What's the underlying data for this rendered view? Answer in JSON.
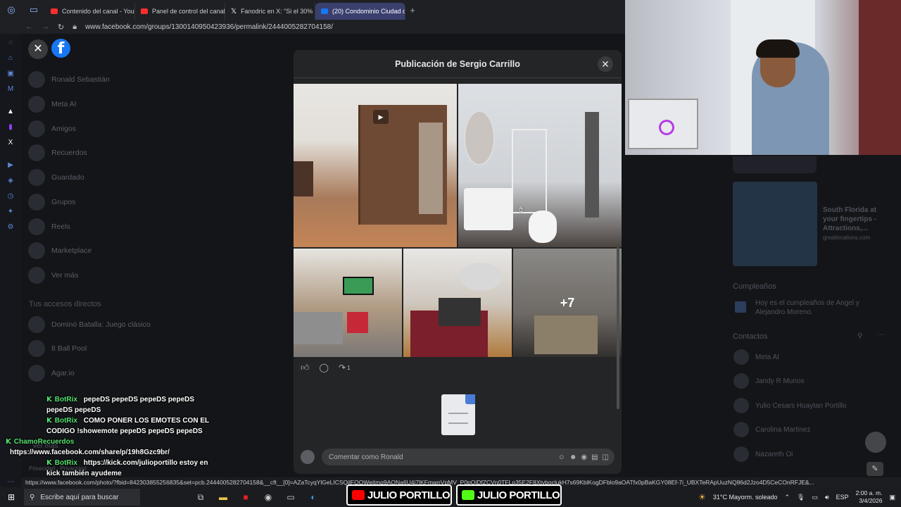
{
  "browser": {
    "tabs": [
      {
        "label": "Contenido del canal - YouT",
        "color": "#ff2d2d"
      },
      {
        "label": "Panel de control del canal",
        "color": "#ff2d2d"
      },
      {
        "label": "Fanodric en X: \"Si el 30%",
        "color": "#ffffff"
      },
      {
        "label": "(20) Condominio Ciudad d",
        "color": "#1877f2"
      }
    ],
    "url": "www.facebook.com/groups/1300140950423936/permalink/2444005282704158/"
  },
  "sidebar": {
    "items": [
      "Ronald Sebastián",
      "Meta AI",
      "Amigos",
      "Recuerdos",
      "Guardado",
      "Grupos",
      "Reels",
      "Marketplace",
      "Ver más"
    ],
    "shortcuts_heading": "Tus accesos directos",
    "shortcuts": [
      "Dominó Batalla: Juego clásico",
      "8 Ball Pool",
      "Agar.io"
    ],
    "more": "Ver más",
    "footer": "Privacidad · Privacidad"
  },
  "modal": {
    "title": "Publicación de Sergio Carrillo",
    "more_photos": "+7",
    "share_count": "1",
    "comment_placeholder": "Comentar como Ronald"
  },
  "right": {
    "ad_text": "South Florida at your fingertips - Attractions,...",
    "ad_domain": "greatlocations.com",
    "birthdays_heading": "Cumpleaños",
    "birthday_text": "Hoy es el cumpleaños de Angel y Alejandro Moreno.",
    "contacts_heading": "Contactos",
    "contacts": [
      "Meta AI",
      "Jandy R Munos",
      "Yulio Cesars Huaytan Portillo",
      "Carolina Martinez",
      "Nazareth Oi"
    ]
  },
  "chat": [
    {
      "user": "BotRix",
      "text": "pepeDS pepeDS pepeDS pepeDS pepeDS pepeDS"
    },
    {
      "user": "BotRix",
      "text": "COMO PONER LOS EMOTES CON EL CODIGO !showemote pepeDS pepeDS pepeDS"
    },
    {
      "user": "ChamoRecuerdos",
      "text": "https://www.facebook.com/share/p/19h8Gzc9br/"
    },
    {
      "user": "BotRix",
      "text": "https://kick.com/julioportillo estoy en kick también ayudeme"
    }
  ],
  "status_url": "https://www.facebook.com/photo/?fbid=842303855256835&set=pcb.2444005282704158&__cft__[0]=AZaTcyqYlGeLICSQjlFQQWeitmq9AQNa6U4j7lKFmwnVpMV_P0pQiDfZCVn0TFLp35E2F8XtvboclukH7s69KblKogDFblo9aOATfx0pBaKGY08Ef-7i_UBXTeRApUuzNQ86d2Jzo4D5CeCOnRFJE&...",
  "taskbar": {
    "search_placeholder": "Escribe aquí para buscar",
    "banner_left": "JULIO PORTILLO",
    "banner_right": "JULIO PORTILLO",
    "weather": "31°C  Mayorm. soleado",
    "lang": "ESP",
    "time": "2:00 a. m.",
    "date": "3/4/2026"
  }
}
